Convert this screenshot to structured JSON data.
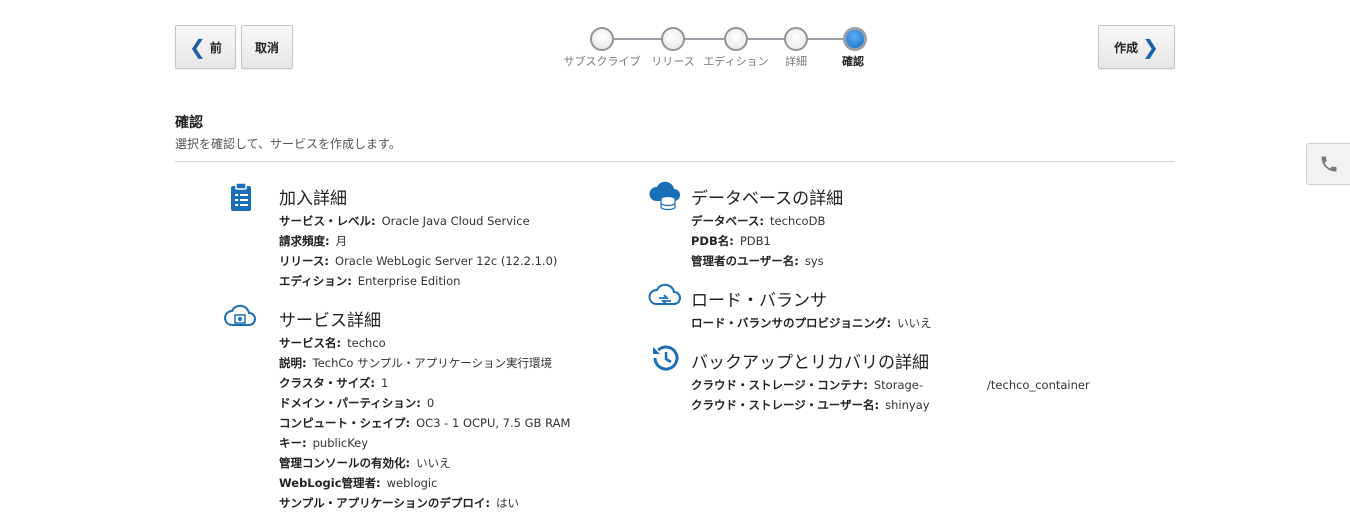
{
  "nav": {
    "prev_label": "前",
    "cancel_label": "取消",
    "create_label": "作成"
  },
  "train": {
    "steps": [
      "サブスクライブ",
      "リリース",
      "エディション",
      "詳細",
      "確認"
    ],
    "current_index": 4
  },
  "header": {
    "title": "確認",
    "subtitle": "選択を確認して、サービスを作成します。"
  },
  "subscription": {
    "title": "加入詳細",
    "rows": [
      {
        "label": "サービス・レベル:",
        "value": "Oracle Java Cloud Service"
      },
      {
        "label": "請求頻度:",
        "value": "月"
      },
      {
        "label": "リリース:",
        "value": "Oracle WebLogic Server 12c (12.2.1.0)"
      },
      {
        "label": "エディション:",
        "value": "Enterprise Edition"
      }
    ]
  },
  "service": {
    "title": "サービス詳細",
    "rows": [
      {
        "label": "サービス名:",
        "value": "techco"
      },
      {
        "label": "説明:",
        "value": "TechCo サンプル・アプリケーション実行環境"
      },
      {
        "label": "クラスタ・サイズ:",
        "value": "1"
      },
      {
        "label": "ドメイン・パーティション:",
        "value": "0"
      },
      {
        "label": "コンピュート・シェイプ:",
        "value": "OC3 - 1 OCPU, 7.5 GB RAM"
      },
      {
        "label": "キー:",
        "value": "publicKey"
      },
      {
        "label": "管理コンソールの有効化:",
        "value": "いいえ"
      },
      {
        "label": "WebLogic管理者:",
        "value": "weblogic"
      },
      {
        "label": "サンプル・アプリケーションのデプロイ:",
        "value": "はい"
      }
    ]
  },
  "database": {
    "title": "データベースの詳細",
    "rows": [
      {
        "label": "データベース:",
        "value": "techcoDB"
      },
      {
        "label": "PDB名:",
        "value": "PDB1"
      },
      {
        "label": "管理者のユーザー名:",
        "value": "sys"
      }
    ]
  },
  "loadbalancer": {
    "title": "ロード・バランサ",
    "rows": [
      {
        "label": "ロード・バランサのプロビジョニング:",
        "value": "いいえ"
      }
    ]
  },
  "backup": {
    "title": "バックアップとリカバリの詳細",
    "rows": [
      {
        "label": "クラウド・ストレージ・コンテナ:",
        "value": "Storage-",
        "value2": "/techco_container"
      },
      {
        "label": "クラウド・ストレージ・ユーザー名:",
        "value": "shinyay"
      }
    ]
  },
  "colors": {
    "accent": "#1f5fa8",
    "icon_blue": "#1a6fb8",
    "current_step": "#1669c9"
  },
  "icons": [
    "chevron-left-icon",
    "chevron-right-icon",
    "clipboard-icon",
    "cloud-gear-icon",
    "cloud-database-icon",
    "cloud-loadbalancer-icon",
    "backup-history-icon",
    "phone-icon"
  ]
}
